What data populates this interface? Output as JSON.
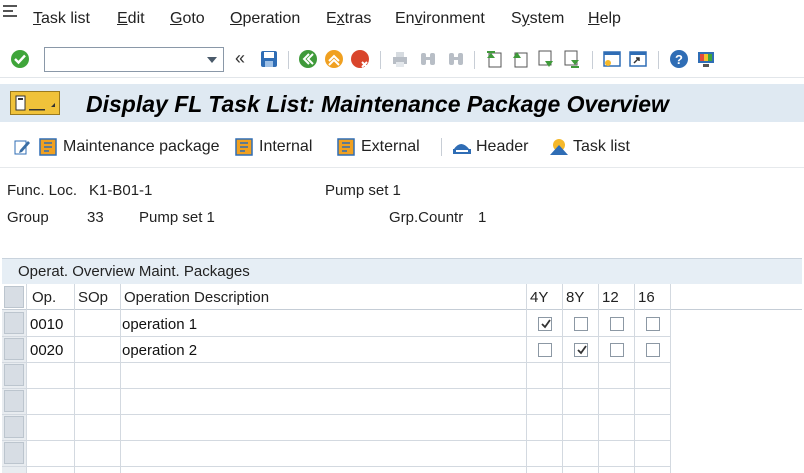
{
  "menubar": {
    "items": [
      {
        "label": "Task list",
        "accel": "T"
      },
      {
        "label": "Edit",
        "accel": "E"
      },
      {
        "label": "Goto",
        "accel": "G"
      },
      {
        "label": "Operation",
        "accel": "O"
      },
      {
        "label": "Extras",
        "accel": "x"
      },
      {
        "label": "Environment",
        "accel": "v"
      },
      {
        "label": "System",
        "accel": "y"
      },
      {
        "label": "Help",
        "accel": "H"
      }
    ]
  },
  "toolbar": {
    "command_value": "",
    "icons": [
      "enter-check-icon",
      "save-icon",
      "back-icon",
      "exit-icon",
      "cancel-icon",
      "print-icon",
      "find-icon",
      "find-next-icon",
      "first-page-icon",
      "previous-page-icon",
      "next-page-icon",
      "last-page-icon",
      "new-session-icon",
      "shortcut-icon",
      "help-icon",
      "customize-layout-icon"
    ]
  },
  "title": {
    "text": "Display FL Task List: Maintenance Package Overview"
  },
  "app_toolbar": {
    "buttons": [
      {
        "label": "Maintenance package",
        "icon": "package-icon"
      },
      {
        "label": "Internal",
        "icon": "internal-icon"
      },
      {
        "label": "External",
        "icon": "external-icon"
      },
      {
        "label": "Header",
        "icon": "header-icon"
      },
      {
        "label": "Task list",
        "icon": "task-list-icon"
      }
    ]
  },
  "header": {
    "func_loc_label": "Func. Loc.",
    "func_loc_value": "K1-B01-1",
    "func_loc_desc": "Pump set 1",
    "group_label": "Group",
    "group_value": "33",
    "group_desc": "Pump set 1",
    "grp_countr_label": "Grp.Countr",
    "grp_countr_value": "1"
  },
  "table": {
    "title": "Operat. Overview Maint. Packages",
    "columns": [
      "Op.",
      "SOp",
      "Operation Description",
      "4Y",
      "8Y",
      "12",
      "16"
    ],
    "rows": [
      {
        "op": "0010",
        "sop": "",
        "desc": "operation 1",
        "checks": [
          true,
          false,
          false,
          false
        ]
      },
      {
        "op": "0020",
        "sop": "",
        "desc": "operation 2",
        "checks": [
          false,
          true,
          false,
          false
        ]
      }
    ],
    "empty_rows": 4
  }
}
